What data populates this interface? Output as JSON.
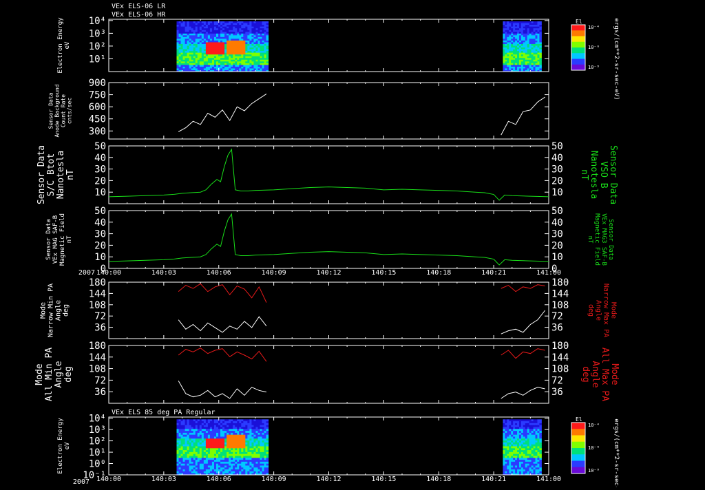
{
  "header": {
    "line1": "VEx ELS-06 LR",
    "line2": "VEx ELS-06 HR"
  },
  "year": "2007",
  "time_ticks": [
    "140:00",
    "140:03",
    "140:06",
    "140:09",
    "140:12",
    "140:15",
    "140:18",
    "140:21",
    "141:00"
  ],
  "colors": {
    "white": "#ffffff",
    "green": "#19e019",
    "red": "#e81a1a",
    "bg": "#000000"
  },
  "colorbar": {
    "label": "El",
    "unit": "ergs/(cm**2-sr-sec-eV)",
    "ticks_top": [
      "10⁻⁴",
      "10⁻⁶",
      "10⁻⁸"
    ]
  },
  "chart_data": [
    {
      "type": "heatmap",
      "id": "spec1",
      "ylabel": [
        "Electron Energy",
        "eV"
      ],
      "yticks": [
        "10⁴",
        "10³",
        "10²",
        "10¹"
      ],
      "ytick_values": [
        4,
        3,
        2,
        1
      ],
      "ylim": [
        0,
        4.1
      ],
      "x_coverage": [
        [
          3.7,
          8.7
        ],
        [
          21.5,
          23.6
        ]
      ]
    },
    {
      "type": "line",
      "id": "count",
      "ylabel": [
        "Sensor Data",
        "Anode Background",
        "Count Rate",
        "cnts/sec"
      ],
      "yticks": [
        "900",
        "750",
        "600",
        "450",
        "300"
      ],
      "ytick_values": [
        900,
        750,
        600,
        450,
        300
      ],
      "ylim": [
        200,
        900
      ],
      "segments": [
        {
          "x": [
            3.8,
            4.2,
            4.6,
            5.0,
            5.4,
            5.8,
            6.2,
            6.6,
            7.0,
            7.4,
            7.8,
            8.2,
            8.6
          ],
          "y": [
            290,
            340,
            420,
            380,
            520,
            470,
            560,
            430,
            600,
            550,
            640,
            700,
            760
          ]
        },
        {
          "x": [
            21.4,
            21.8,
            22.2,
            22.6,
            23.0,
            23.4,
            23.8
          ],
          "y": [
            250,
            420,
            380,
            540,
            560,
            660,
            720
          ]
        }
      ]
    },
    {
      "type": "line",
      "id": "b1",
      "ylabel": [
        "Sensor Data",
        "S/C Btot",
        "Nanotesla",
        "nT"
      ],
      "ylabel_right": [
        "Sensor Data",
        "VSO B",
        "Nanotesla",
        "nT"
      ],
      "yticks": [
        "50",
        "40",
        "30",
        "20",
        "10"
      ],
      "ytick_values": [
        50,
        40,
        30,
        20,
        10
      ],
      "ylim": [
        0,
        50
      ],
      "x": [
        0,
        1,
        2,
        3,
        3.5,
        4,
        4.5,
        5,
        5.3,
        5.6,
        5.9,
        6.1,
        6.3,
        6.5,
        6.7,
        6.9,
        7.2,
        7.6,
        8,
        9,
        10,
        11,
        12,
        13,
        14,
        15,
        16,
        17,
        18,
        19,
        20,
        20.5,
        21,
        21.3,
        21.6,
        22,
        23,
        24
      ],
      "y": [
        6,
        6.5,
        7,
        7.5,
        8,
        9,
        9.5,
        10,
        12,
        17,
        21,
        19,
        32,
        42,
        47,
        12,
        11,
        11,
        11.5,
        12,
        13,
        14,
        14.5,
        14,
        13.5,
        12,
        12.5,
        12,
        11.5,
        11,
        10,
        9.5,
        8,
        3,
        7.5,
        7,
        6.5,
        6
      ]
    },
    {
      "type": "line",
      "id": "b2",
      "ylabel": [
        "Sensor Data",
        "VEx MAG SAF-B",
        "Magnetic Field",
        "nT"
      ],
      "ylabel_right": [
        "Sensor Data",
        "VEx MAG3 SAF-B",
        "Magnetic Field",
        "nT"
      ],
      "yticks": [
        "50",
        "40",
        "30",
        "20",
        "10",
        "0"
      ],
      "ytick_values": [
        50,
        40,
        30,
        20,
        10,
        0
      ],
      "ylim": [
        0,
        50
      ],
      "x": [
        0,
        1,
        2,
        3,
        3.5,
        4,
        4.5,
        5,
        5.3,
        5.6,
        5.9,
        6.1,
        6.3,
        6.5,
        6.7,
        6.9,
        7.2,
        7.6,
        8,
        9,
        10,
        11,
        12,
        13,
        14,
        15,
        16,
        17,
        18,
        19,
        20,
        20.5,
        21,
        21.3,
        21.6,
        22,
        23,
        24
      ],
      "y": [
        6,
        6.5,
        7,
        7.5,
        8,
        9,
        9.5,
        10,
        12,
        17,
        21,
        19,
        32,
        42,
        47,
        12,
        11,
        11,
        11.5,
        12,
        13,
        14,
        14.5,
        14,
        13.5,
        12,
        12.5,
        12,
        11.5,
        11,
        10,
        9.5,
        8,
        3,
        7.5,
        7,
        6.5,
        6
      ]
    },
    {
      "type": "line",
      "id": "pa1",
      "ylabel": [
        "Mode",
        "Narrow Min PA",
        "Angle",
        "deg"
      ],
      "ylabel_right": [
        "Mode",
        "Narrow Max PA",
        "Angle",
        "deg"
      ],
      "yticks": [
        "180",
        "144",
        "108",
        "72",
        "36"
      ],
      "ytick_values": [
        180,
        144,
        108,
        72,
        36
      ],
      "ylim": [
        0,
        180
      ],
      "min_segments": [
        {
          "x": [
            3.8,
            4.2,
            4.6,
            5.0,
            5.4,
            5.8,
            6.2,
            6.6,
            7.0,
            7.4,
            7.8,
            8.2,
            8.6
          ],
          "y": [
            60,
            30,
            45,
            25,
            50,
            35,
            20,
            40,
            30,
            55,
            35,
            70,
            40
          ]
        },
        {
          "x": [
            21.4,
            21.8,
            22.2,
            22.6,
            23.0,
            23.4,
            23.8
          ],
          "y": [
            15,
            25,
            30,
            20,
            45,
            60,
            90
          ]
        }
      ],
      "max_segments": [
        {
          "x": [
            3.8,
            4.2,
            4.6,
            5.0,
            5.4,
            5.8,
            6.2,
            6.6,
            7.0,
            7.4,
            7.8,
            8.2,
            8.6
          ],
          "y": [
            150,
            170,
            160,
            175,
            150,
            165,
            172,
            140,
            168,
            158,
            130,
            165,
            115
          ]
        },
        {
          "x": [
            21.4,
            21.8,
            22.2,
            22.6,
            23.0,
            23.4,
            23.8
          ],
          "y": [
            160,
            170,
            150,
            165,
            160,
            172,
            168
          ]
        }
      ]
    },
    {
      "type": "line",
      "id": "pa2",
      "ylabel": [
        "Mode",
        "All Min PA",
        "Angle",
        "deg"
      ],
      "ylabel_right": [
        "Mode",
        "All Max PA",
        "Angle",
        "deg"
      ],
      "yticks": [
        "180",
        "144",
        "108",
        "72",
        "36"
      ],
      "ytick_values": [
        180,
        144,
        108,
        72,
        36
      ],
      "ylim": [
        0,
        180
      ],
      "min_segments": [
        {
          "x": [
            3.8,
            4.2,
            4.6,
            5.0,
            5.4,
            5.8,
            6.2,
            6.6,
            7.0,
            7.4,
            7.8,
            8.2,
            8.6
          ],
          "y": [
            70,
            30,
            20,
            25,
            40,
            20,
            30,
            15,
            45,
            25,
            50,
            40,
            35
          ]
        },
        {
          "x": [
            21.4,
            21.8,
            22.2,
            22.6,
            23.0,
            23.4,
            23.8
          ],
          "y": [
            15,
            30,
            35,
            25,
            40,
            50,
            45
          ]
        }
      ],
      "max_segments": [
        {
          "x": [
            3.8,
            4.2,
            4.6,
            5.0,
            5.4,
            5.8,
            6.2,
            6.6,
            7.0,
            7.4,
            7.8,
            8.2,
            8.6
          ],
          "y": [
            150,
            168,
            160,
            172,
            155,
            165,
            170,
            145,
            160,
            150,
            138,
            162,
            130
          ]
        },
        {
          "x": [
            21.4,
            21.8,
            22.2,
            22.6,
            23.0,
            23.4,
            23.8
          ],
          "y": [
            150,
            165,
            140,
            160,
            155,
            170,
            165
          ]
        }
      ]
    },
    {
      "type": "heatmap",
      "id": "spec2",
      "title": "VEx ELS 85 deg PA Regular",
      "ylabel": [
        "Electron Energy",
        "eV"
      ],
      "yticks": [
        "10⁴",
        "10³",
        "10²",
        "10¹",
        "10⁰",
        "10⁻¹"
      ],
      "ytick_values": [
        4,
        3,
        2,
        1,
        0,
        -1
      ],
      "ylim": [
        -1,
        4.1
      ],
      "x_coverage": [
        [
          3.7,
          8.7
        ],
        [
          21.5,
          23.6
        ]
      ]
    }
  ]
}
